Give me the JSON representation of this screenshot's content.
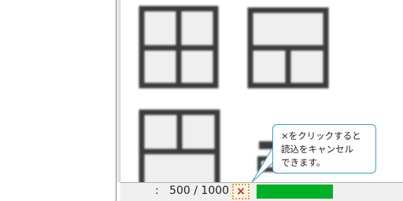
{
  "status": {
    "counter_text": ":   500 / 1000",
    "cancel_label": "×",
    "progress": 1.0,
    "progress_color": "#00b026"
  },
  "tooltip": {
    "lines": [
      "×をクリックすると",
      "読込をキャンセル",
      "できます。"
    ]
  },
  "gallery": {
    "items": [
      {
        "icon": "four-panel-layout-icon"
      },
      {
        "icon": "top-wide-two-bottom-layout-icon"
      },
      {
        "icon": "two-top-wide-bottom-layout-icon"
      },
      {
        "icon": "partial-layout-icon"
      }
    ]
  },
  "colors": {
    "accent": "#3aa0cc",
    "focus": "#f0a020",
    "cancel": "#d02020"
  }
}
